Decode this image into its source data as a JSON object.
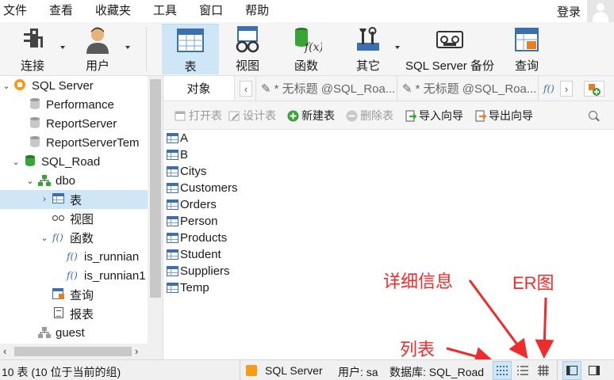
{
  "menu": [
    "文件",
    "查看",
    "收藏夹",
    "工具",
    "窗口",
    "帮助"
  ],
  "account": {
    "login_label": "登录"
  },
  "toolbar": [
    {
      "label": "连接",
      "icon": "connection-plug-icon",
      "has_dropdown": true
    },
    {
      "label": "用户",
      "icon": "user-icon",
      "has_dropdown": true
    },
    {
      "label": "表",
      "icon": "table-icon",
      "active": true
    },
    {
      "label": "视图",
      "icon": "view-glasses-icon"
    },
    {
      "label": "函数",
      "icon": "function-icon"
    },
    {
      "label": "其它",
      "icon": "tools-icon",
      "has_dropdown": true
    },
    {
      "label": "SQL Server 备份",
      "icon": "backup-tape-icon"
    },
    {
      "label": "查询",
      "icon": "query-table-icon"
    }
  ],
  "tree": [
    {
      "label": "SQL Server",
      "icon": "server-icon",
      "expand": "open",
      "level": 0
    },
    {
      "label": "Performance",
      "icon": "database-icon",
      "level": 1
    },
    {
      "label": "ReportServer",
      "icon": "database-icon",
      "level": 1
    },
    {
      "label": "ReportServerTem",
      "icon": "database-icon",
      "level": 1
    },
    {
      "label": "SQL_Road",
      "icon": "database-open-icon",
      "expand": "open",
      "level": 1
    },
    {
      "label": "dbo",
      "icon": "schema-icon",
      "expand": "open",
      "level": 2
    },
    {
      "label": "表",
      "icon": "table-icon",
      "expand": "closed",
      "level": 3,
      "selected": true
    },
    {
      "label": "视图",
      "icon": "view-glasses-icon",
      "level": 3
    },
    {
      "label": "函数",
      "icon": "function-icon",
      "expand": "open",
      "level": 3
    },
    {
      "label": "is_runnian",
      "icon": "function-icon",
      "level": 4
    },
    {
      "label": "is_runnian1",
      "icon": "function-icon",
      "level": 4
    },
    {
      "label": "查询",
      "icon": "query-icon",
      "level": 3
    },
    {
      "label": "报表",
      "icon": "report-icon",
      "level": 3
    },
    {
      "label": "guest",
      "icon": "schema-icon",
      "level": 2
    }
  ],
  "tabs": {
    "objects_label": "对象",
    "query_tabs": [
      "* 无标题 @SQL_Roa...",
      "* 无标题 @SQL_Roa..."
    ]
  },
  "subtoolbar": [
    {
      "label": "打开表",
      "icon": "open-table-icon",
      "enabled": false
    },
    {
      "label": "设计表",
      "icon": "design-table-icon",
      "enabled": false
    },
    {
      "label": "新建表",
      "icon": "new-table-icon",
      "enabled": true
    },
    {
      "label": "删除表",
      "icon": "delete-table-icon",
      "enabled": false
    },
    {
      "label": "导入向导",
      "icon": "import-wizard-icon",
      "enabled": true
    },
    {
      "label": "导出向导",
      "icon": "export-wizard-icon",
      "enabled": true
    }
  ],
  "tables": [
    "A",
    "B",
    "Citys",
    "Customers",
    "Orders",
    "Person",
    "Products",
    "Student",
    "Suppliers",
    "Temp"
  ],
  "annotations": {
    "detail": "详细信息",
    "er": "ER图",
    "list": "列表",
    "color": "#ef2c2c"
  },
  "status": {
    "count": "10 表 (10 位于当前的组)",
    "server": "SQL Server",
    "user": "用户: sa",
    "database": "数据库: SQL_Road"
  },
  "colors": {
    "accent": "#cfe6f7",
    "annotation": "#ef2c2c",
    "db_active": "#3aa335"
  }
}
